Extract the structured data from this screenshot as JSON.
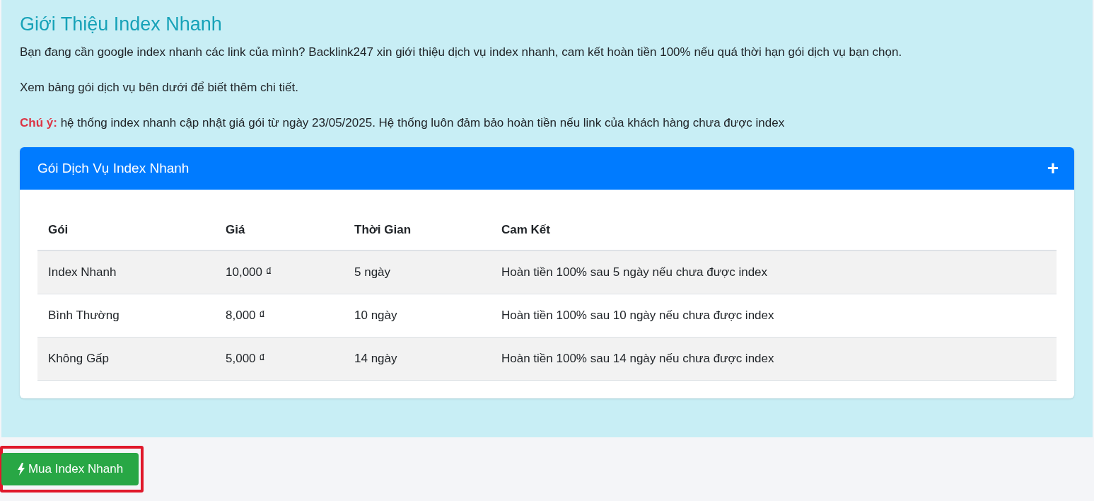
{
  "intro": {
    "title": "Giới Thiệu Index Nhanh",
    "paragraphs": [
      "Bạn đang cần google index nhanh các link của mình? Backlink247 xin giới thiệu dịch vụ index nhanh, cam kết hoàn tiền 100% nếu quá thời hạn gói dịch vụ bạn chọn.",
      "Xem bảng gói dịch vụ bên dưới để biết thêm chi tiết."
    ],
    "note": {
      "label": "Chú ý:",
      "text": "hệ thống index nhanh cập nhật giá gói từ ngày 23/05/2025. Hệ thống luôn đảm bảo hoàn tiền nếu link của khách hàng chưa được index"
    },
    "card": {
      "title": "Gói Dịch Vụ Index Nhanh",
      "toggle": "+",
      "table": {
        "columns": [
          "Gói",
          "Giá",
          "Thời Gian",
          "Cam Kết"
        ],
        "rows": [
          [
            "Index Nhanh",
            "10,000 ₫",
            "5 ngày",
            "Hoàn tiền 100% sau 5 ngày nếu chưa được index"
          ],
          [
            "Bình Thường",
            "8,000 ₫",
            "10 ngày",
            "Hoàn tiền 100% sau 10 ngày nếu chưa được index"
          ],
          [
            "Không Gấp",
            "5,000 ₫",
            "14 ngày",
            "Hoàn tiền 100% sau 14 ngày nếu chưa được index"
          ]
        ]
      }
    }
  },
  "buy_button": {
    "label": "Mua Index Nhanh"
  }
}
